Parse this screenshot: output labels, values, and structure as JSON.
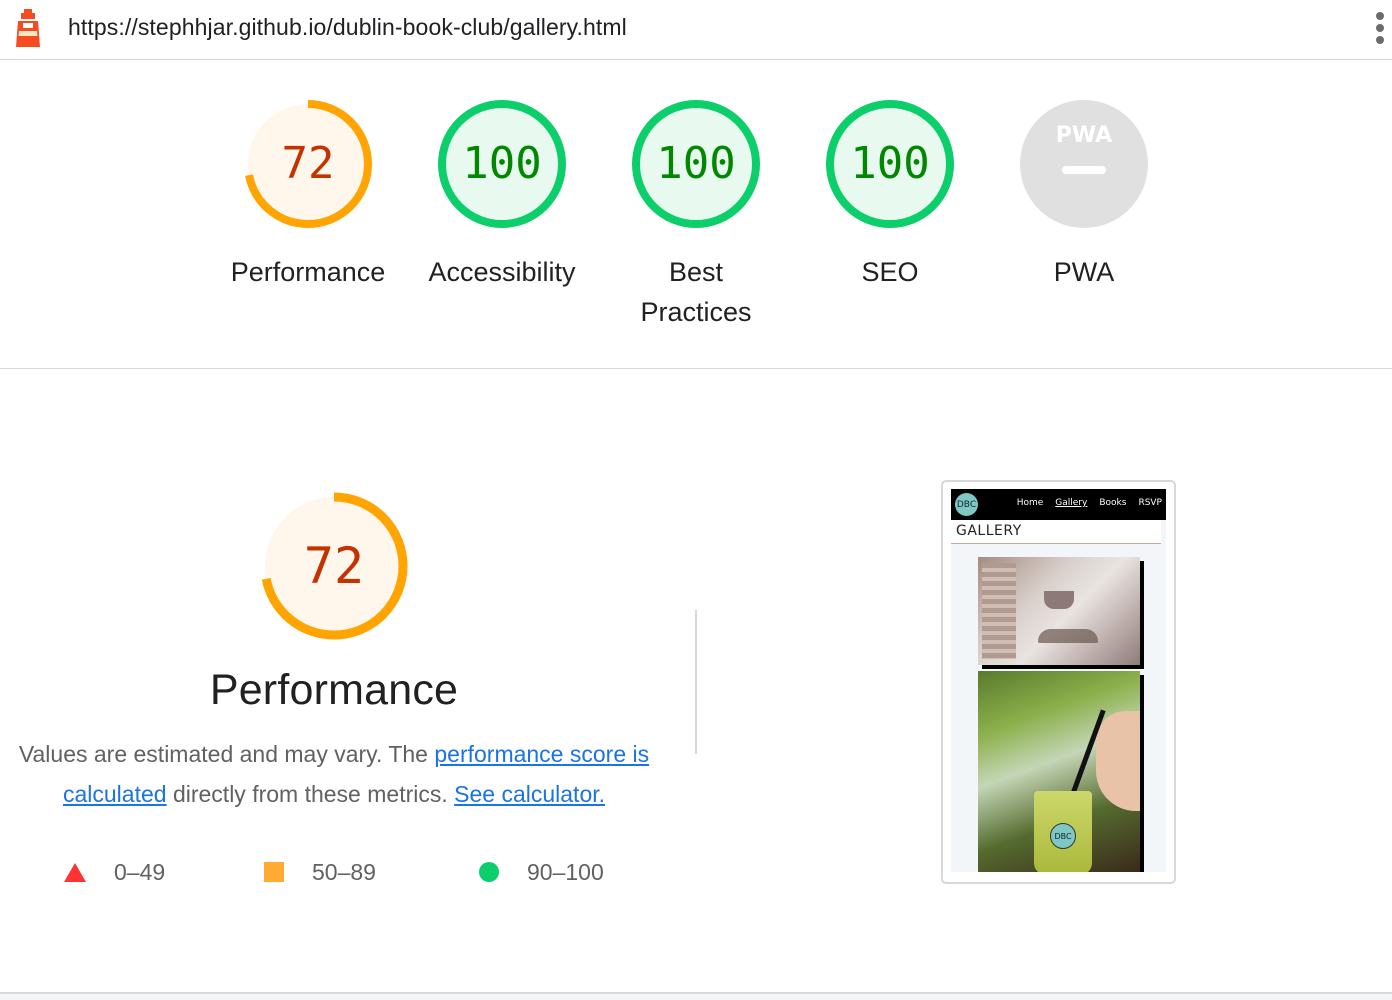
{
  "url_bar": {
    "url": "https://stephhjar.github.io/dublin-book-club/gallery.html",
    "logo_icon": "lighthouse-icon",
    "menu_icon": "more-vert-icon"
  },
  "gauges": [
    {
      "label": "Performance",
      "score": "72",
      "fraction": 0.72,
      "status": "average"
    },
    {
      "label": "Accessibility",
      "score": "100",
      "fraction": 1.0,
      "status": "pass"
    },
    {
      "label": "Best Practices",
      "score": "100",
      "fraction": 1.0,
      "status": "pass"
    },
    {
      "label": "SEO",
      "score": "100",
      "fraction": 1.0,
      "status": "pass"
    },
    {
      "label": "PWA",
      "score": "",
      "fraction": 0,
      "status": "na",
      "badge_text": "PWA"
    }
  ],
  "performance": {
    "score": "72",
    "fraction": 0.72,
    "title": "Performance",
    "desc_prefix": "Values are estimated and may vary. The",
    "link_score": "performance score is calculated",
    "desc_middle": "directly from these metrics.",
    "link_calc": "See calculator.",
    "legend": [
      {
        "shape": "triangle",
        "range": "0–49"
      },
      {
        "shape": "square",
        "range": "50–89"
      },
      {
        "shape": "circle",
        "range": "90–100"
      }
    ]
  },
  "thumbnail": {
    "logo": "DBC",
    "nav": [
      "Home",
      "Gallery",
      "Books",
      "RSVP"
    ],
    "heading": "GALLERY",
    "cup_badge": "DBC"
  },
  "colors": {
    "average": "#ffa400",
    "average_text": "#c33300",
    "average_bg": "#fff6ec",
    "pass": "#0cce6b",
    "pass_text": "#008800",
    "pass_bg": "#e8f9ef",
    "na": "#e0e0e0",
    "link": "#1a73e8"
  }
}
